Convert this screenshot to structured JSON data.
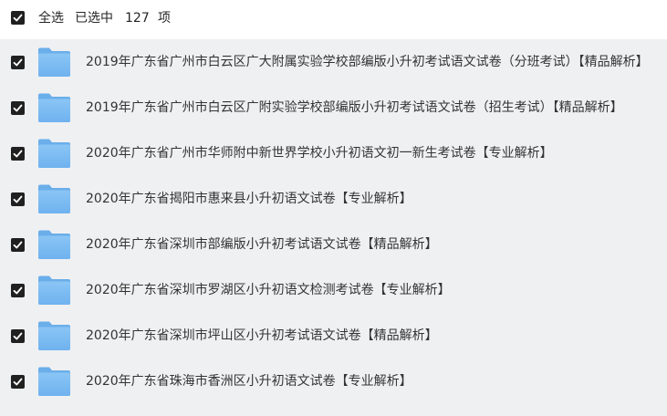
{
  "header": {
    "select_all_label": "全选",
    "selected_label": "已选中",
    "selected_count": "127",
    "unit_label": "项"
  },
  "colors": {
    "checkbox": "#202020",
    "list_background": "#eff0f2",
    "folder": "#7cbcf3"
  },
  "files": [
    {
      "name": "2019年广东省广州市白云区广大附属实验学校部编版小升初考试语文试卷（分班考试）【精品解析】",
      "checked": true,
      "icon": "folder-icon"
    },
    {
      "name": "2019年广东省广州市白云区广附实验学校部编版小升初考试语文试卷（招生考试）【精品解析】",
      "checked": true,
      "icon": "folder-icon"
    },
    {
      "name": "2020年广东省广州市华师附中新世界学校小升初语文初一新生考试卷【专业解析】",
      "checked": true,
      "icon": "folder-icon"
    },
    {
      "name": "2020年广东省揭阳市惠来县小升初语文试卷【专业解析】",
      "checked": true,
      "icon": "folder-icon"
    },
    {
      "name": "2020年广东省深圳市部编版小升初考试语文试卷【精品解析】",
      "checked": true,
      "icon": "folder-icon"
    },
    {
      "name": "2020年广东省深圳市罗湖区小升初语文检测考试卷【专业解析】",
      "checked": true,
      "icon": "folder-icon"
    },
    {
      "name": "2020年广东省深圳市坪山区小升初考试语文试卷【精品解析】",
      "checked": true,
      "icon": "folder-icon"
    },
    {
      "name": "2020年广东省珠海市香洲区小升初语文试卷【专业解析】",
      "checked": true,
      "icon": "folder-icon"
    }
  ]
}
